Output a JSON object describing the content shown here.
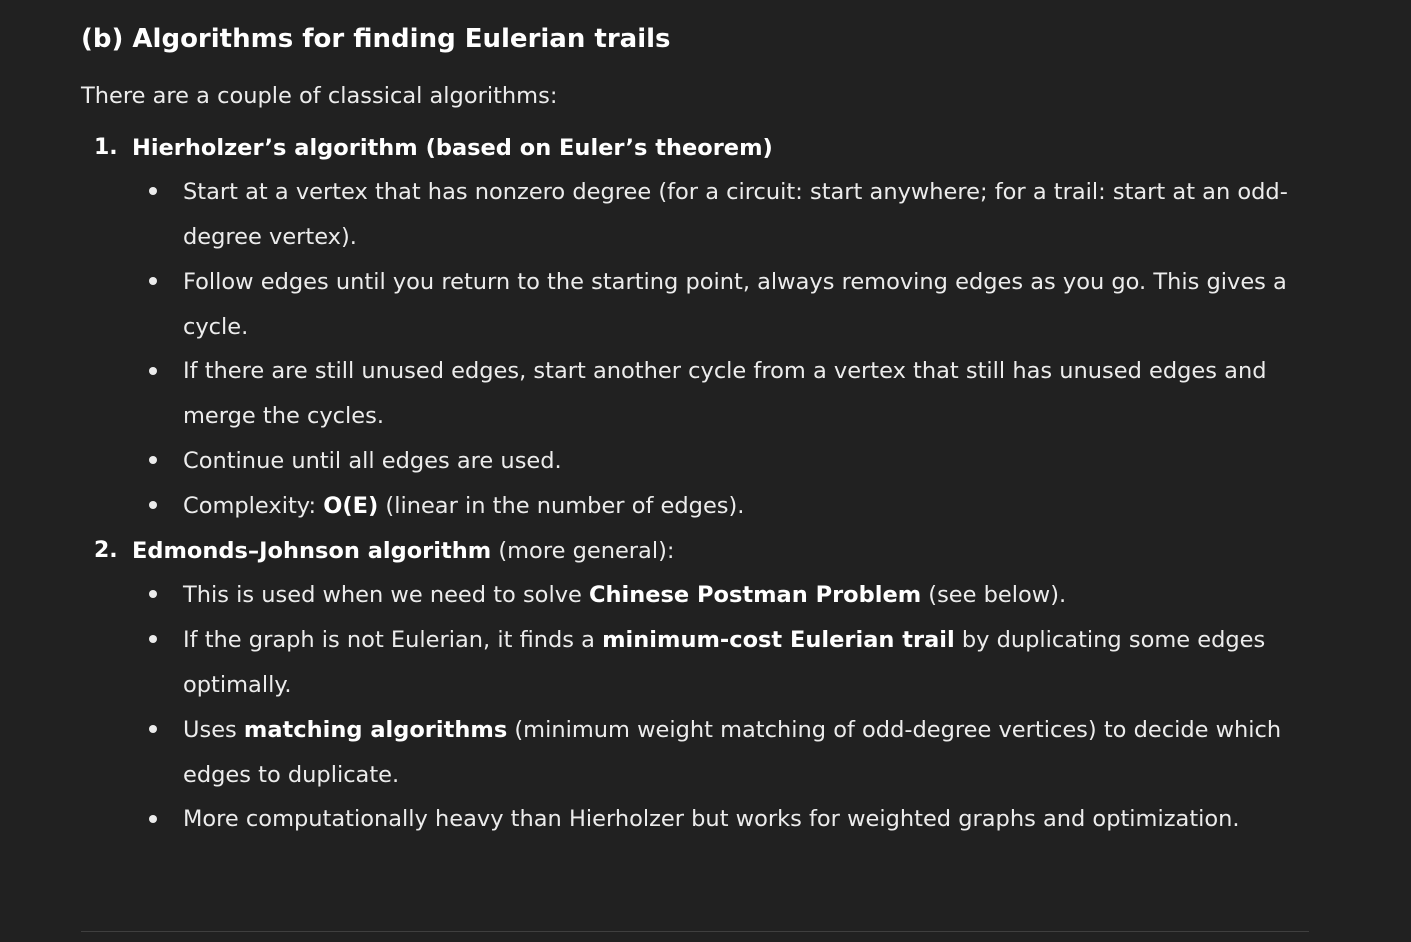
{
  "heading": "(b) Algorithms for finding Eulerian trails",
  "intro": "There are a couple of classical algorithms:",
  "algorithms": [
    {
      "marker": "1.",
      "title_bold": "Hierholzer’s algorithm (based on Euler’s theorem)",
      "title_rest": "",
      "bullets": [
        {
          "text": "Start at a vertex that has nonzero degree (for a circuit: start anywhere; for a trail: start at an odd-degree vertex)."
        },
        {
          "text": "Follow edges until you return to the starting point, always removing edges as you go. This gives a cycle."
        },
        {
          "text": "If there are still unused edges, start another cycle from a vertex that still has unused edges and merge the cycles."
        },
        {
          "text": "Continue until all edges are used."
        },
        {
          "pre": "Complexity: ",
          "bold": "O(E)",
          "post": " (linear in the number of edges)."
        }
      ]
    },
    {
      "marker": "2.",
      "title_bold": "Edmonds–Johnson algorithm",
      "title_rest": " (more general):",
      "bullets": [
        {
          "pre": "This is used when we need to solve ",
          "bold": "Chinese Postman Problem",
          "post": " (see below)."
        },
        {
          "pre": "If the graph is not Eulerian, it finds a ",
          "bold": "minimum-cost Eulerian trail",
          "post": " by duplicating some edges optimally."
        },
        {
          "pre": "Uses ",
          "bold": "matching algorithms",
          "post": " (minimum weight matching of odd-degree vertices) to decide which edges to duplicate."
        },
        {
          "text": "More computationally heavy than Hierholzer but works for weighted graphs and optimization."
        }
      ]
    }
  ]
}
